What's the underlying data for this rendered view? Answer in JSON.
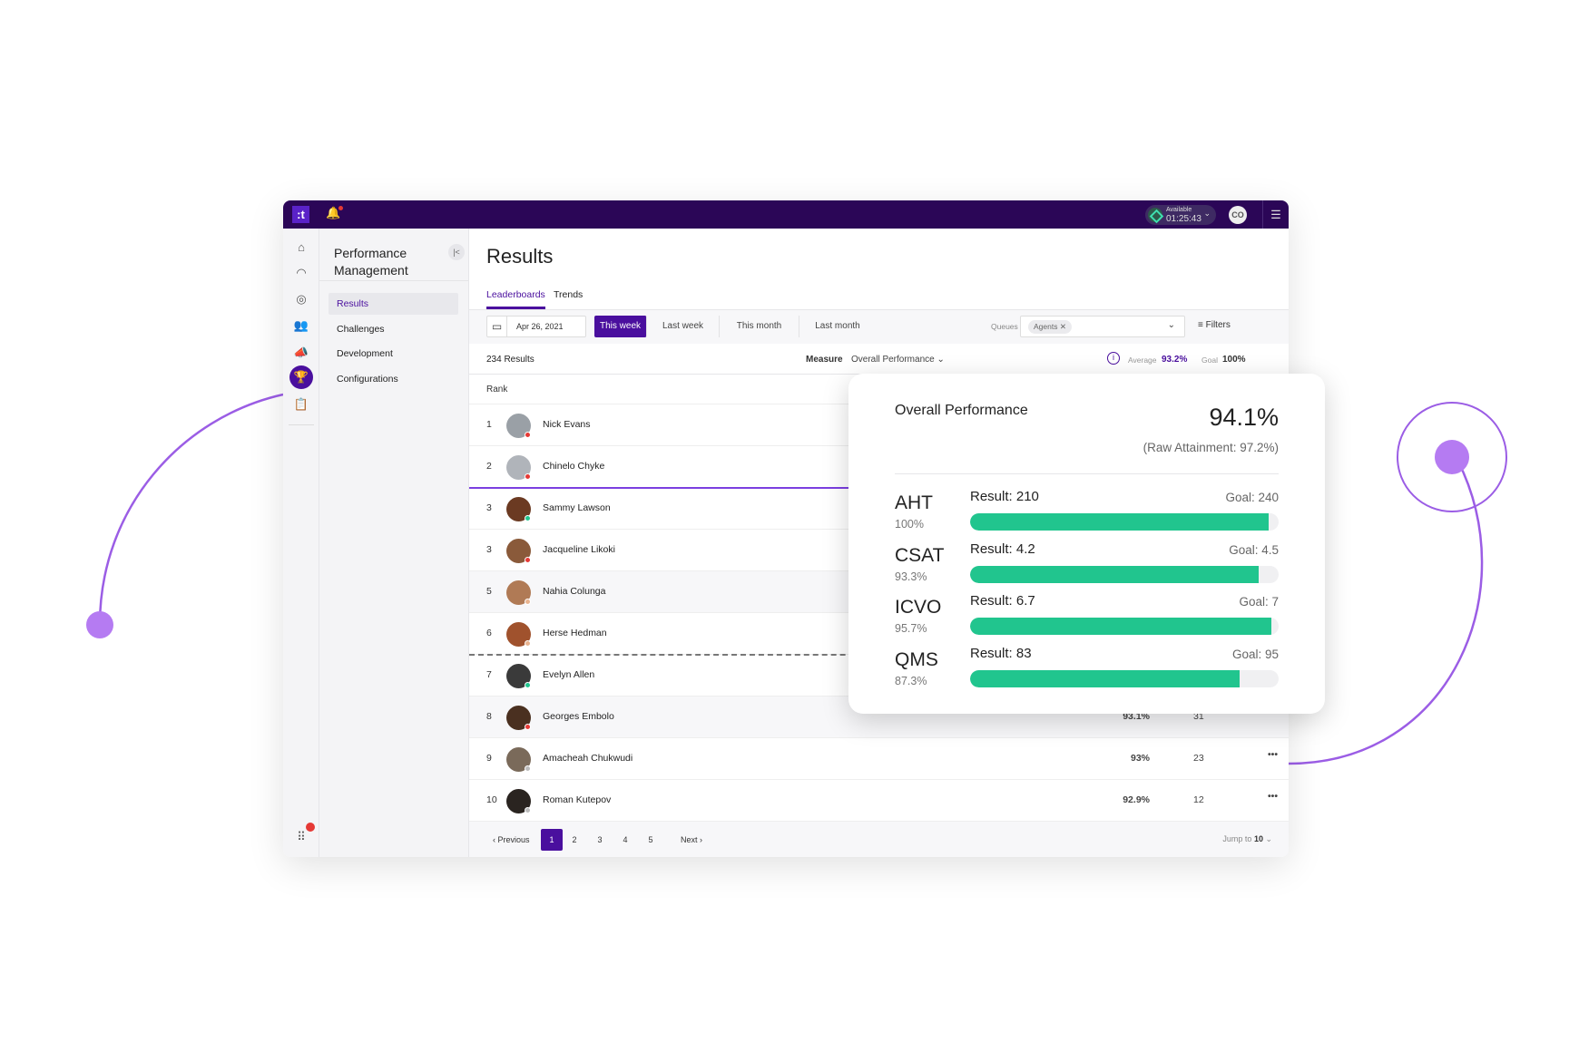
{
  "colors": {
    "brand": "#2b0657",
    "accent": "#4a0f9e",
    "progress": "#21c58e",
    "decor": "#b57bf2"
  },
  "topbar": {
    "logo": ":t",
    "status_label": "Available",
    "status_timer": "01:25:43",
    "user_initials": "CO"
  },
  "rail": {
    "icons": [
      "home-icon",
      "gauge-icon",
      "compass-icon",
      "people-icon",
      "megaphone-icon",
      "trophy-icon",
      "clipboard-icon",
      "apps-grid-icon"
    ],
    "active": "trophy-icon"
  },
  "nav": {
    "title": "Performance Management",
    "items": [
      {
        "label": "Results",
        "active": true
      },
      {
        "label": "Challenges"
      },
      {
        "label": "Development"
      },
      {
        "label": "Configurations"
      }
    ]
  },
  "main": {
    "title": "Results",
    "tabs": [
      {
        "label": "Leaderboards",
        "active": true
      },
      {
        "label": "Trends"
      }
    ],
    "date": "Apr 26, 2021",
    "periods": [
      {
        "label": "This week",
        "active": true
      },
      {
        "label": "Last week"
      },
      {
        "label": "This month"
      },
      {
        "label": "Last month"
      }
    ],
    "queues_label": "Queues",
    "queue_chip": "Agents",
    "filters_label": "Filters",
    "results_count": "234 Results",
    "measure_label": "Measure",
    "measure_value": "Overall Performance",
    "average_label": "Average",
    "average_value": "93.2%",
    "goal_label": "Goal",
    "goal_value": "100%",
    "rank_header": "Rank",
    "rows": [
      {
        "rank": "1",
        "name": "Nick Evans",
        "status": "#e53935",
        "avatar": "#9aa0a6"
      },
      {
        "rank": "2",
        "name": "Chinelo Chyke",
        "status": "#e53935",
        "avatar": "#b0b4ba"
      },
      {
        "rank": "3",
        "name": "Sammy Lawson",
        "status": "#21c58e",
        "avatar": "#6b3a22"
      },
      {
        "rank": "3",
        "name": "Jacqueline Likoki",
        "status": "#e53935",
        "avatar": "#8a5a3a"
      },
      {
        "rank": "5",
        "name": "Nahia Colunga",
        "status": "#e8b38f",
        "avatar": "#b07a55"
      },
      {
        "rank": "6",
        "name": "Herse Hedman",
        "status": "#e8b38f",
        "avatar": "#a0522d"
      },
      {
        "rank": "7",
        "name": "Evelyn Allen",
        "status": "#21c58e",
        "avatar": "#3a3a3a"
      },
      {
        "rank": "8",
        "name": "Georges Embolo",
        "status": "#e53935",
        "avatar": "#4a3020",
        "score": "93.1%",
        "count": "31"
      },
      {
        "rank": "9",
        "name": "Amacheah Chukwudi",
        "status": "#bbbbbb",
        "avatar": "#7a6a5a",
        "score": "93%",
        "count": "23"
      },
      {
        "rank": "10",
        "name": "Roman Kutepov",
        "status": "#bbbbbb",
        "avatar": "#2a2420",
        "score": "92.9%",
        "count": "12"
      }
    ],
    "pagination": {
      "previous": "Previous",
      "pages": [
        "1",
        "2",
        "3",
        "4",
        "5"
      ],
      "current": "1",
      "next": "Next",
      "jump_label": "Jump to",
      "jump_value": "10"
    }
  },
  "card": {
    "title": "Overall Performance",
    "value": "94.1%",
    "raw": "(Raw Attainment: 97.2%)",
    "metrics": [
      {
        "name": "AHT",
        "percent": "100%",
        "result": "Result: 210",
        "goal": "Goal: 240",
        "fill_pct": 96.7
      },
      {
        "name": "CSAT",
        "percent": "93.3%",
        "result": "Result: 4.2",
        "goal": "Goal: 4.5",
        "fill_pct": 93.5
      },
      {
        "name": "ICVO",
        "percent": "95.7%",
        "result": "Result: 6.7",
        "goal": "Goal: 7",
        "fill_pct": 97.7
      },
      {
        "name": "QMS",
        "percent": "87.3%",
        "result": "Result: 83",
        "goal": "Goal: 95",
        "fill_pct": 87.3
      }
    ]
  }
}
